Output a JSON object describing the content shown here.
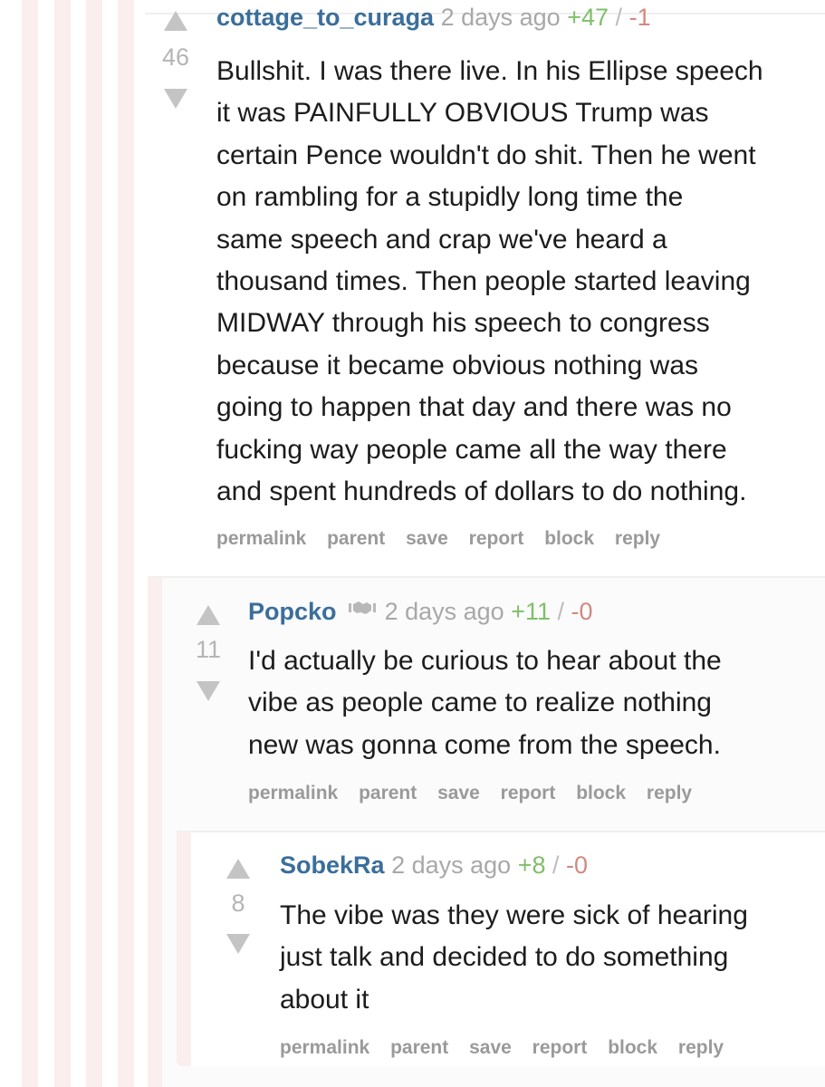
{
  "comments": [
    {
      "author": "cottage_to_curaga",
      "time": "2 days ago",
      "upvotes": "+47",
      "separator": "/",
      "downvotes": "-1",
      "score": "46",
      "body_lines": [
        "Bullshit. I was there live. In his Ellipse speech",
        "it was PAINFULLY OBVIOUS Trump was",
        "certain Pence wouldn't do shit. Then he went",
        "on rambling for a stupidly long time the",
        "same speech and crap we've heard a",
        "thousand times. Then people started leaving",
        "MIDWAY through his speech to congress",
        "because it became obvious nothing was",
        "going to happen that day and there was no",
        "fucking way people came all the way there",
        "and spent hundreds of dollars to do nothing."
      ],
      "actions": [
        "permalink",
        "parent",
        "save",
        "report",
        "block",
        "reply"
      ]
    },
    {
      "author": "Popcko",
      "flair_icon": "handshake-flair-icon",
      "flair_glyph": "ᶀ🤝ᵻ",
      "time": "2 days ago",
      "upvotes": "+11",
      "separator": "/",
      "downvotes": "-0",
      "score": "11",
      "body_lines": [
        "I'd actually be curious to hear about the",
        "vibe as people came to realize nothing",
        "new was gonna come from the speech."
      ],
      "actions": [
        "permalink",
        "parent",
        "save",
        "report",
        "block",
        "reply"
      ]
    },
    {
      "author": "SobekRa",
      "time": "2 days ago",
      "upvotes": "+8",
      "separator": "/",
      "downvotes": "-0",
      "score": "8",
      "body_lines": [
        "The vibe was they were sick of hearing",
        "just talk and decided to do something",
        "about it"
      ],
      "actions": [
        "permalink",
        "parent",
        "save",
        "report",
        "block",
        "reply"
      ]
    }
  ],
  "colors": {
    "author": "#3a6e9c",
    "upvotes": "#7fbf6a",
    "downvotes": "#d08a80",
    "meta": "#a8a8a8",
    "stripe": "#fbeeee",
    "arrow": "#c4c4c4"
  }
}
